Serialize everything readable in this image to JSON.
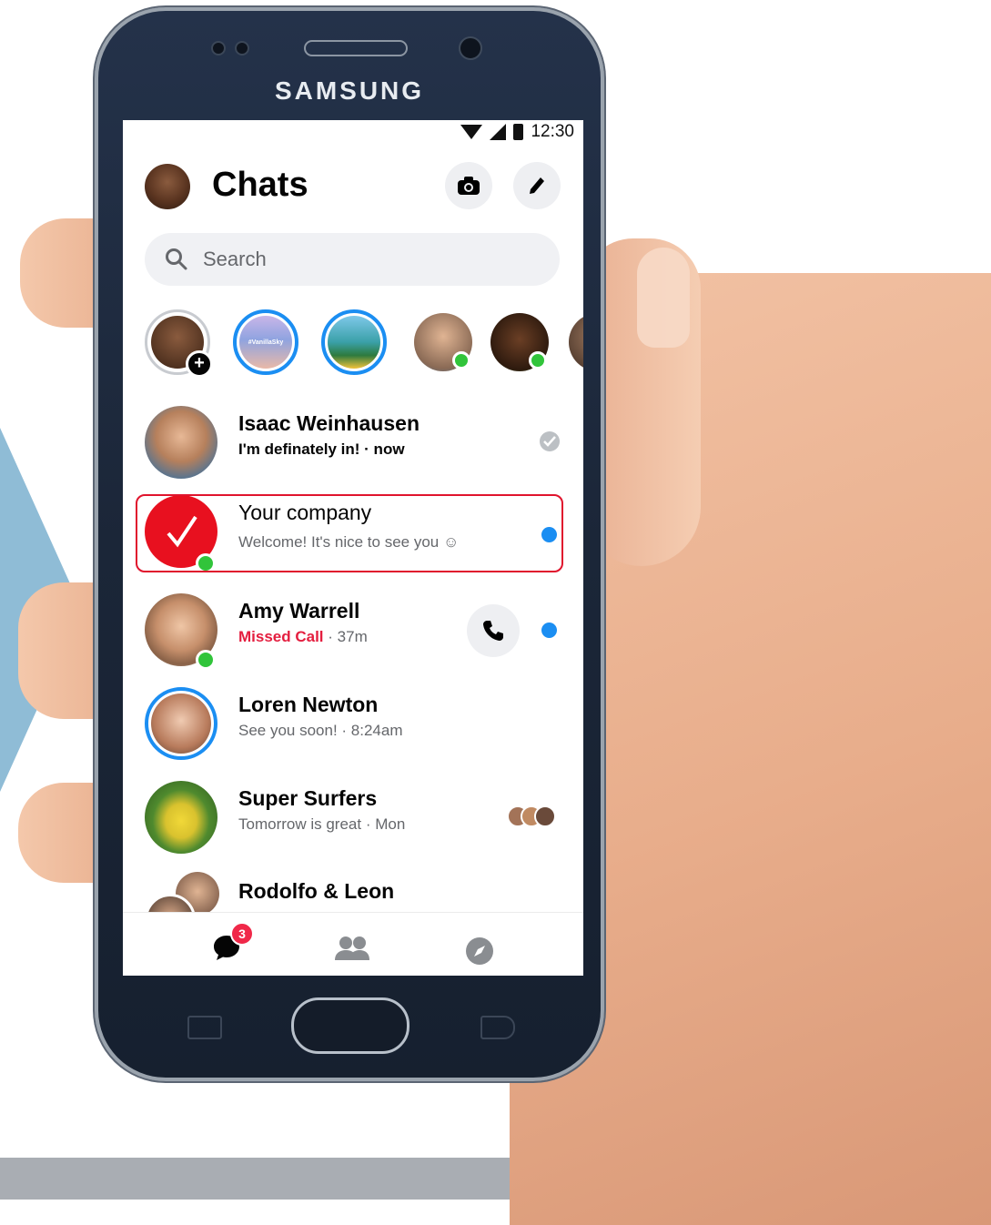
{
  "device": {
    "brand": "SAMSUNG"
  },
  "status_bar": {
    "time": "12:30"
  },
  "header": {
    "title": "Chats"
  },
  "search": {
    "placeholder": "Search"
  },
  "stories": [
    {
      "label": "#VanillaSky"
    }
  ],
  "chats": [
    {
      "name": "Isaac Weinhausen",
      "preview": "I'm definately in! · now"
    },
    {
      "name": "Your company",
      "preview": "Welcome! It's nice to see you ☺"
    },
    {
      "name": "Amy Warrell",
      "missed": "Missed Call",
      "time": " · 37m"
    },
    {
      "name": "Loren Newton",
      "preview": "See you soon! · 8:24am"
    },
    {
      "name": "Super Surfers",
      "preview": "Tomorrow is great · Mon"
    },
    {
      "name": "Rodolfo & Leon"
    }
  ],
  "nav": {
    "chats_badge": "3"
  },
  "colors": {
    "accent": "#1b8ef2",
    "online": "#31c43a",
    "missed": "#e41e3f",
    "highlight": "#e0142d",
    "company": "#e8101f"
  },
  "icons": [
    "search-icon",
    "camera-icon",
    "pencil-icon",
    "phone-icon",
    "check-icon",
    "chat-bubble-icon",
    "people-icon",
    "compass-icon"
  ]
}
